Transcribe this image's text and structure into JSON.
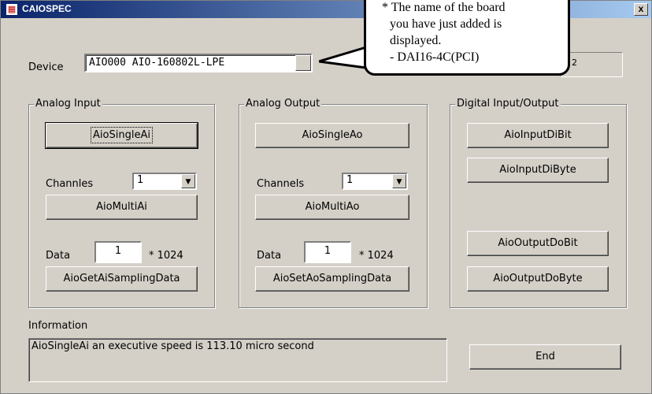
{
  "window": {
    "title": "CAIOSPEC",
    "close_label": "x"
  },
  "device": {
    "label": "Device",
    "value": "AIO000 AIO-160802L-LPE"
  },
  "callout": {
    "lines": [
      "* The name of the board",
      "you have just added is",
      "displayed.",
      "- DAI16-4C(PCI)"
    ],
    "fragment": "2"
  },
  "analog_input": {
    "title": "Analog Input",
    "single_btn": "AioSingleAi",
    "channels_label": "Channles",
    "channels_value": "1",
    "multi_btn": "AioMultiAi",
    "data_label": "Data",
    "data_value": "1",
    "data_unit": "* 1024",
    "sampling_btn": "AioGetAiSamplingData"
  },
  "analog_output": {
    "title": "Analog Output",
    "single_btn": "AioSingleAo",
    "channels_label": "Channels",
    "channels_value": "1",
    "multi_btn": "AioMultiAo",
    "data_label": "Data",
    "data_value": "1",
    "data_unit": "* 1024",
    "sampling_btn": "AioSetAoSamplingData"
  },
  "digital": {
    "title": "Digital Input/Output",
    "btn_input_bit": "AioInputDiBit",
    "btn_input_byte": "AioInputDiByte",
    "btn_output_bit": "AioOutputDoBit",
    "btn_output_byte": "AioOutputDoByte"
  },
  "information": {
    "label": "Information",
    "text": "AioSingleAi an executive speed is 113.10 micro second"
  },
  "end_btn": "End"
}
